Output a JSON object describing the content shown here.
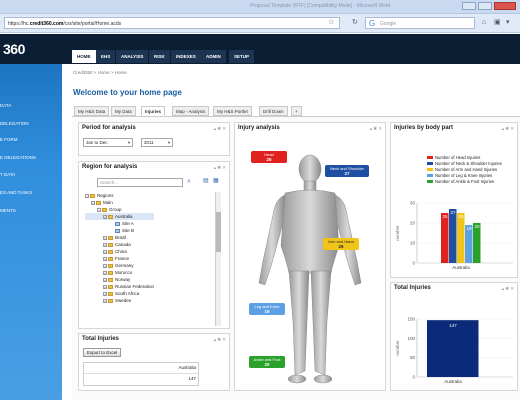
{
  "browser": {
    "window_title": "Proposal Template (RTF) [Compatibility Mode] - Microsoft Word",
    "url_prefix": "https://hc.",
    "url_domain": "credit360.com",
    "url_path": "/csr/site/portal/Home.acds",
    "search_placeholder": "Google"
  },
  "app": {
    "logo": "360",
    "menu": [
      "HOME",
      "EHS",
      "ANALYSIS",
      "RISK",
      "INDEXES",
      "ADMIN",
      "SETUP"
    ]
  },
  "sidebar": {
    "items": [
      "DATA",
      "DELEGATION",
      "E FORM",
      "E DELEGATIONS",
      "T DATA",
      "ES AND TASKS",
      "MENTS"
    ]
  },
  "breadcrumb": "Credit360 > Home > Home",
  "welcome": "Welcome to your home page",
  "tabs": [
    "My H&S Data",
    "My Data",
    "Injuries",
    "Map - Analysis",
    "My H&S Portlet",
    "Drill Down",
    "+"
  ],
  "period": {
    "title": "Period for analysis",
    "month_range": "Jan to Dec",
    "year": "2011"
  },
  "region": {
    "title": "Region for analysis",
    "search_placeholder": "Search...",
    "tree": [
      "Regions",
      "Main",
      "Group",
      "Australia",
      "Site A",
      "Site B",
      "Brazil",
      "Canada",
      "China",
      "France",
      "Germany",
      "Morocco",
      "Norway",
      "Russian Federation",
      "South Africa",
      "Sweden"
    ]
  },
  "total_injuries_left": {
    "title": "Total Injuries",
    "export_label": "Export to Excel",
    "col_header": "Australia",
    "value": "147"
  },
  "injury_analysis": {
    "title": "Injury analysis",
    "labels": [
      {
        "name": "Head",
        "value": "25",
        "color": "#e0221f"
      },
      {
        "name": "Neck and Shoulder",
        "value": "27",
        "color": "#1e4fa3"
      },
      {
        "name": "Arm and Hand",
        "value": "25",
        "color": "#f0c419"
      },
      {
        "name": "Leg and Knee",
        "value": "19",
        "color": "#5da0e6"
      },
      {
        "name": "Ankle and Foot",
        "value": "20",
        "color": "#2aa12a"
      }
    ]
  },
  "injuries_by_body_part": {
    "title": "Injuries by body part",
    "ylabel": "number"
  },
  "total_injuries_right": {
    "title": "Total Injuries",
    "ylabel": "number"
  },
  "chart_data": [
    {
      "type": "bar",
      "title": "Injuries by body part",
      "categories": [
        "Australia"
      ],
      "ylabel": "number",
      "ylim": [
        0,
        30
      ],
      "yticks": [
        0,
        10,
        20,
        30
      ],
      "legend_position": "top-right",
      "series": [
        {
          "name": "Number of Head Injuries",
          "values": [
            25
          ],
          "color": "#e0221f"
        },
        {
          "name": "Number of Neck & Shoulder Injuries",
          "values": [
            27
          ],
          "color": "#1e4fa3"
        },
        {
          "name": "Number of Arm and Hand Injuries",
          "values": [
            25
          ],
          "color": "#f0c419"
        },
        {
          "name": "Number of Leg & Knee Injuries",
          "values": [
            19
          ],
          "color": "#5da0e6"
        },
        {
          "name": "Number of Ankle & Foot Injuries",
          "values": [
            20
          ],
          "color": "#2aa12a"
        }
      ]
    },
    {
      "type": "bar",
      "title": "Total Injuries",
      "categories": [
        "Australia"
      ],
      "ylabel": "number",
      "ylim": [
        0,
        150
      ],
      "yticks": [
        0,
        50,
        100,
        150
      ],
      "series": [
        {
          "values": [
            147
          ],
          "color": "#0b2a7a"
        }
      ]
    }
  ]
}
